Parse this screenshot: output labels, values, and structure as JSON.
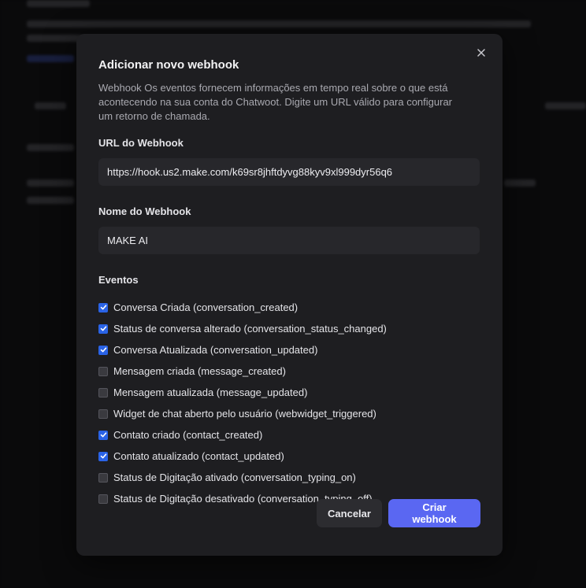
{
  "modal": {
    "title": "Adicionar novo webhook",
    "description": "Webhook Os eventos fornecem informações em tempo real sobre o que está acontecendo na sua conta do Chatwoot. Digite um URL válido para configurar um retorno de chamada.",
    "url_label": "URL do Webhook",
    "url_value": "https://hook.us2.make.com/k69sr8jhftdyvg88kyv9xl999dyr56q6",
    "name_label": "Nome do Webhook",
    "name_value": "MAKE AI",
    "events_label": "Eventos",
    "events": [
      {
        "label": "Conversa Criada (conversation_created)",
        "checked": true
      },
      {
        "label": "Status de conversa alterado (conversation_status_changed)",
        "checked": true
      },
      {
        "label": "Conversa Atualizada (conversation_updated)",
        "checked": true
      },
      {
        "label": "Mensagem criada (message_created)",
        "checked": false
      },
      {
        "label": "Mensagem atualizada (message_updated)",
        "checked": false
      },
      {
        "label": "Widget de chat aberto pelo usuário (webwidget_triggered)",
        "checked": false
      },
      {
        "label": "Contato criado (contact_created)",
        "checked": true
      },
      {
        "label": "Contato atualizado (contact_updated)",
        "checked": true
      },
      {
        "label": "Status de Digitação ativado (conversation_typing_on)",
        "checked": false
      },
      {
        "label": "Status de Digitação desativado (conversation_typing_off)",
        "checked": false
      }
    ],
    "cancel_label": "Cancelar",
    "create_label": "Criar webhook"
  },
  "colors": {
    "accent": "#5a67f2",
    "checkbox_checked": "#2a63e6",
    "modal_bg": "#1e1e21"
  },
  "icons": {
    "close": "close-icon",
    "check": "check-icon"
  }
}
